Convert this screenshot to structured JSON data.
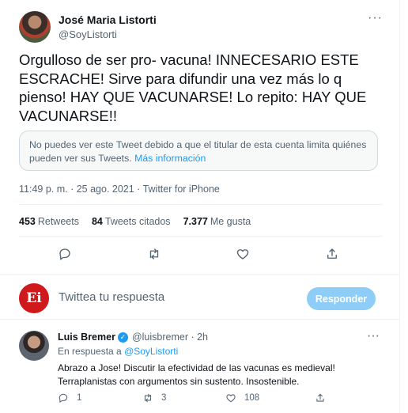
{
  "tweet": {
    "author_name": "José Maria Listorti",
    "author_handle": "@SoyListorti",
    "text": "Orgulloso de ser pro- vacuna! INNECESARIO ESTE ESCRACHE! Sirve para difundir una vez más lo q pienso! HAY QUE VACUNARSE! Lo repito: HAY QUE VACUNARSE!!",
    "notice_text": "No puedes ver este Tweet debido a que el titular de esta cuenta limita quiénes pueden ver sus Tweets.",
    "notice_link": "Más información",
    "timestamp": "11:49 p. m. · 25 ago. 2021 · Twitter for iPhone",
    "retweets_count": "453",
    "retweets_label": "Retweets",
    "quotes_count": "84",
    "quotes_label": "Tweets citados",
    "likes_count": "7.377",
    "likes_label": "Me gusta",
    "more_icon": "···"
  },
  "reply_box": {
    "avatar_text": "Ei",
    "placeholder": "Twittea tu respuesta",
    "button_label": "Responder"
  },
  "reply": {
    "author_name": "Luis Bremer",
    "author_handle": "@luisbremer · 2h",
    "in_reply_prefix": "En respuesta a",
    "in_reply_handle": "@SoyListorti",
    "text": "Abrazo a Jose! Discutir la efectividad de las vacunas es medieval! Terraplanistas con argumentos sin sustento. Insostenible.",
    "reply_count": "1",
    "retweet_count": "3",
    "like_count": "108",
    "more_icon": "···"
  },
  "colors": {
    "accent": "#1d9bf0",
    "reply_button_disabled": "#8ecdf8",
    "logo_red": "#d0191d"
  }
}
